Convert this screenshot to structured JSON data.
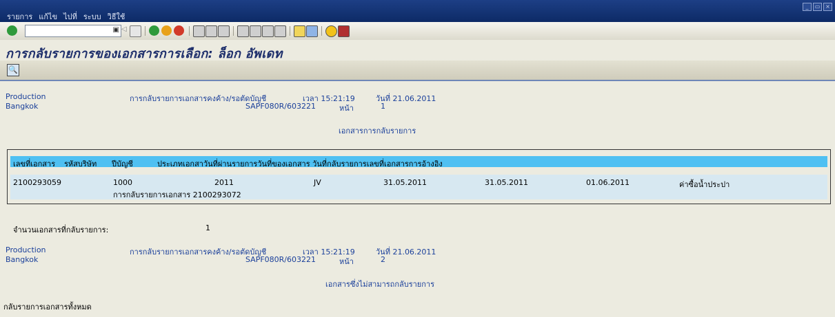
{
  "menu": [
    "รายการ",
    "แก้ไข",
    "ไปที่",
    "ระบบ",
    "วิธีใช้"
  ],
  "window_buttons": [
    "minimize",
    "restore",
    "close"
  ],
  "command_field": {
    "value": ""
  },
  "page_title": "การกลับรายการของเอกสารการเลือก: ล็อก อัพเดท",
  "header1": {
    "company": "Production",
    "city": "Bangkok",
    "report_title": "การกลับรายการเอกสารคงค้าง/รอตัดบัญชี",
    "time_label": "เวลา 15:21:19",
    "date_label": "วันที่ 21.06.2011",
    "program": "SAPF080R/603221",
    "page_label": "หน้า",
    "page_no": "1"
  },
  "section1_title": "เอกสารการกลับรายการ",
  "table": {
    "headers": [
      "เลขที่เอกสาร",
      "รหัสบริษัท",
      "ปีบัญชี",
      "ประเภทเอกสาวันที่ผ่านรายการวันที่ของเอกสาร วันที่กลับรายการเลขที่เอกสารการอ้างอิง"
    ],
    "row": {
      "doc_no": "2100293059",
      "company_code": "1000",
      "fiscal_year": "2011",
      "doc_type": "JV",
      "posting_date": "31.05.2011",
      "doc_date": "31.05.2011",
      "reversal_date": "01.06.2011",
      "reference": "ค่าซื้อน้ำประปา",
      "reversal_doc": "การกลับรายการเอกสาร 2100293072"
    }
  },
  "count": {
    "label": "จำนวนเอกสารที่กลับรายการ:",
    "value": "1"
  },
  "header2": {
    "company": "Production",
    "city": "Bangkok",
    "report_title": "การกลับรายการเอกสารคงค้าง/รอตัดบัญชี",
    "time_label": "เวลา 15:21:19",
    "date_label": "วันที่ 21.06.2011",
    "program": "SAPF080R/603221",
    "page_label": "หน้า",
    "page_no": "2"
  },
  "section2_title": "เอกสารซึ่งไม่สามารถกลับรายการ",
  "footer_text": "กลับรายการเอกสารทั้งหมด",
  "colors": {
    "menubar": "#1d3f86",
    "table_header": "#4fc0f2",
    "row_bg": "#d7e8f1",
    "background": "#ecebe0",
    "blue_text": "#1a3f9a"
  }
}
